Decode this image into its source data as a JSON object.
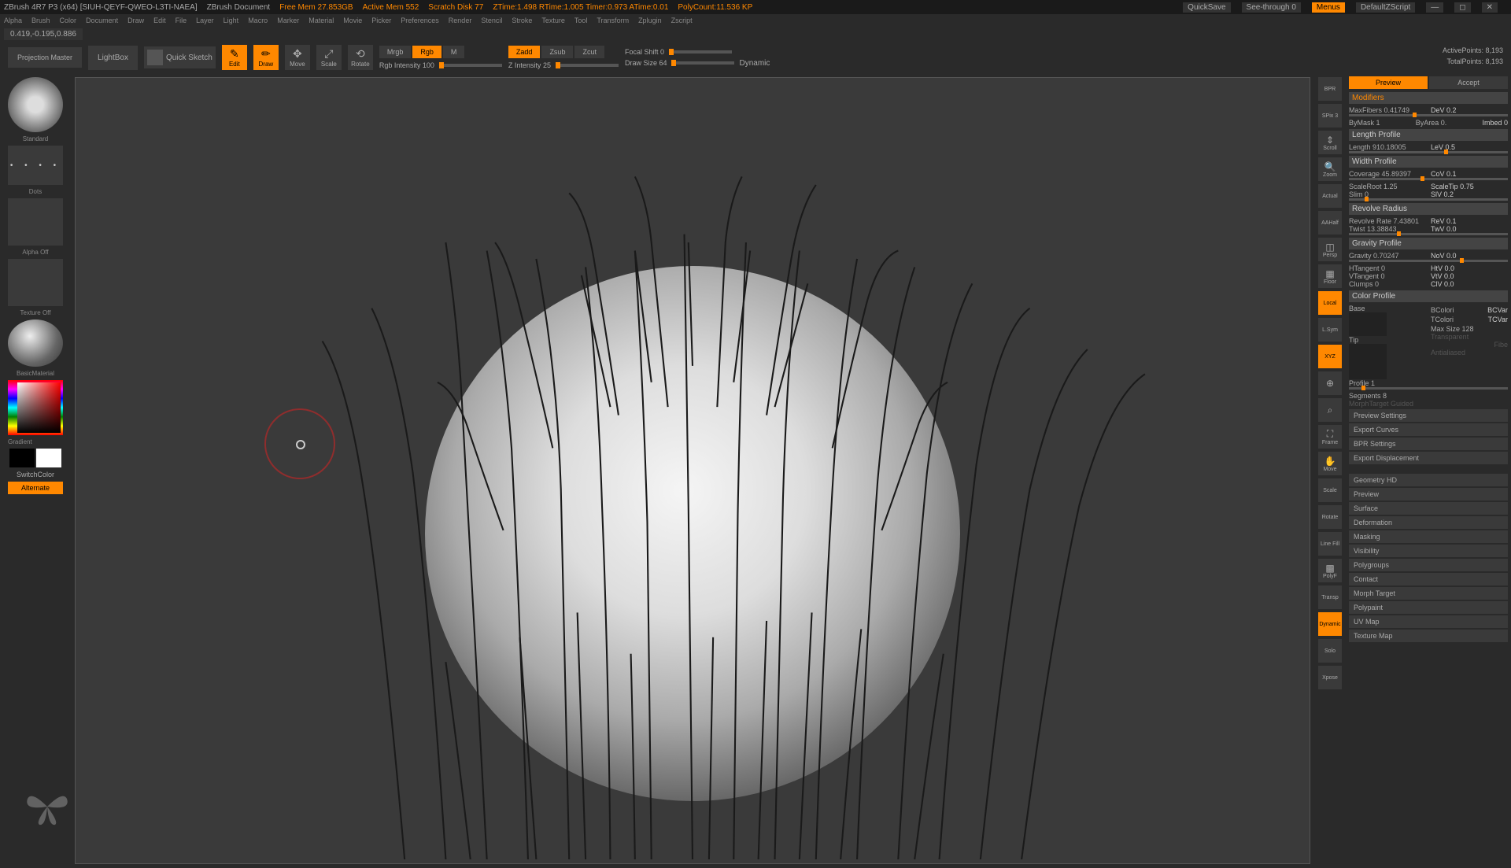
{
  "titlebar": {
    "app": "ZBrush 4R7 P3 (x64) [SIUH-QEYF-QWEO-L3TI-NAEA]",
    "doc": "ZBrush Document",
    "freemem": "Free Mem 27.853GB",
    "activemem": "Active Mem 552",
    "scratch": "Scratch Disk 77",
    "ztime": "ZTime:1.498 RTime:1.005 Timer:0.973 ATime:0.01",
    "polycount": "PolyCount:11.536 KP",
    "quicksave": "QuickSave",
    "seethrough": "See-through   0",
    "menus": "Menus",
    "script": "DefaultZScript"
  },
  "menu": [
    "Alpha",
    "Brush",
    "Color",
    "Document",
    "Draw",
    "Edit",
    "File",
    "Layer",
    "Light",
    "Macro",
    "Marker",
    "Material",
    "Movie",
    "Picker",
    "Preferences",
    "Render",
    "Stencil",
    "Stroke",
    "Texture",
    "Tool",
    "Transform",
    "Zplugin",
    "Zscript"
  ],
  "coords": "0.419,-0.195,0.886",
  "toolbar": {
    "projection": "Projection\nMaster",
    "lightbox": "LightBox",
    "quicksketch": "Quick\nSketch",
    "edit": "Edit",
    "draw": "Draw",
    "move": "Move",
    "scale": "Scale",
    "rotate": "Rotate",
    "mrgb": "Mrgb",
    "rgb": "Rgb",
    "m": "M",
    "zadd": "Zadd",
    "zsub": "Zsub",
    "zcut": "Zcut",
    "rgbint": "Rgb Intensity 100",
    "zint": "Z Intensity 25",
    "focal": "Focal Shift 0",
    "drawsize": "Draw Size 64",
    "dynamic": "Dynamic",
    "activepts": "ActivePoints: 8,193",
    "totalpts": "TotalPoints: 8,193"
  },
  "left": {
    "brush": "Standard",
    "stroke": "Dots",
    "alpha": "Alpha Off",
    "texture": "Texture Off",
    "material": "BasicMaterial",
    "gradient": "Gradient",
    "switch": "SwitchColor",
    "alternate": "Alternate"
  },
  "rtools": {
    "bpr": "BPR",
    "spix": "SPix 3",
    "scroll": "Scroll",
    "zoom": "Zoom",
    "actual": "Actual",
    "aahalf": "AAHalf",
    "persp": "Persp",
    "floor": "Floor",
    "local": "Local",
    "lsym": "L.Sym",
    "xyz": "XYZ",
    "frame": "Frame",
    "moveview": "Move",
    "scaleview": "Scale",
    "rotateview": "Rotate",
    "linefill": "Line Fill",
    "polyf": "PolyF",
    "transp": "Transp",
    "dynamic": "Dynamic",
    "solo": "Solo",
    "xpose": "Xpose"
  },
  "panel": {
    "preview": "Preview",
    "accept": "Accept",
    "modifiers": "Modifiers",
    "maxfibers": "MaxFibers 0.41749",
    "dev": "DeV 0.2",
    "bymask": "ByMask 1",
    "byarea": "ByArea 0.",
    "imbed": "Imbed 0",
    "lengthprofile": "Length Profile",
    "length": "Length 910.18005",
    "lev": "LeV 0.5",
    "widthprofile": "Width Profile",
    "coverage": "Coverage 45.89397",
    "cov": "CoV 0.1",
    "scaleroot": "ScaleRoot 1.25",
    "scaletip": "ScaleTip 0.75",
    "slim": "Slim 0",
    "slv": "SlV 0.2",
    "revolveradius": "Revolve Radius",
    "revolverate": "Revolve Rate 7.43801",
    "rev": "ReV 0.1",
    "twist": "Twist 13.38843",
    "twv": "TwV 0.0",
    "gravityprofile": "Gravity Profile",
    "gravity": "Gravity 0.70247",
    "nov": "NoV 0.0",
    "htangent": "HTangent 0",
    "htv": "HtV 0.0",
    "vtangent": "VTangent 0",
    "vtv": "VtV 0.0",
    "clumps": "Clumps 0",
    "clv": "ClV 0.0",
    "colorprofile": "Color Profile",
    "base": "Base",
    "tip": "Tip",
    "bcolori": "BColori",
    "bcvar": "BCVar",
    "tcolori": "TColori",
    "tcvar": "TCVar",
    "maxsize": "Max Size 128",
    "fibe": "Fibe",
    "transparent": "Transparent",
    "antialiased": "Antialiased",
    "profile1": "Profile 1",
    "segments": "Segments 8",
    "morphtarget_g": "MorphTarget Guided",
    "previewsettings": "Preview Settings",
    "exportcurves": "Export Curves",
    "bprsettings": "BPR Settings",
    "exportdisp": "Export Displacement",
    "geometryhd": "Geometry HD",
    "preview2": "Preview",
    "surface": "Surface",
    "deformation": "Deformation",
    "masking": "Masking",
    "visibility": "Visibility",
    "polygroups": "Polygroups",
    "contact": "Contact",
    "morphtarget": "Morph Target",
    "polypaint": "Polypaint",
    "uvmap": "UV Map",
    "texturemap": "Texture Map"
  }
}
